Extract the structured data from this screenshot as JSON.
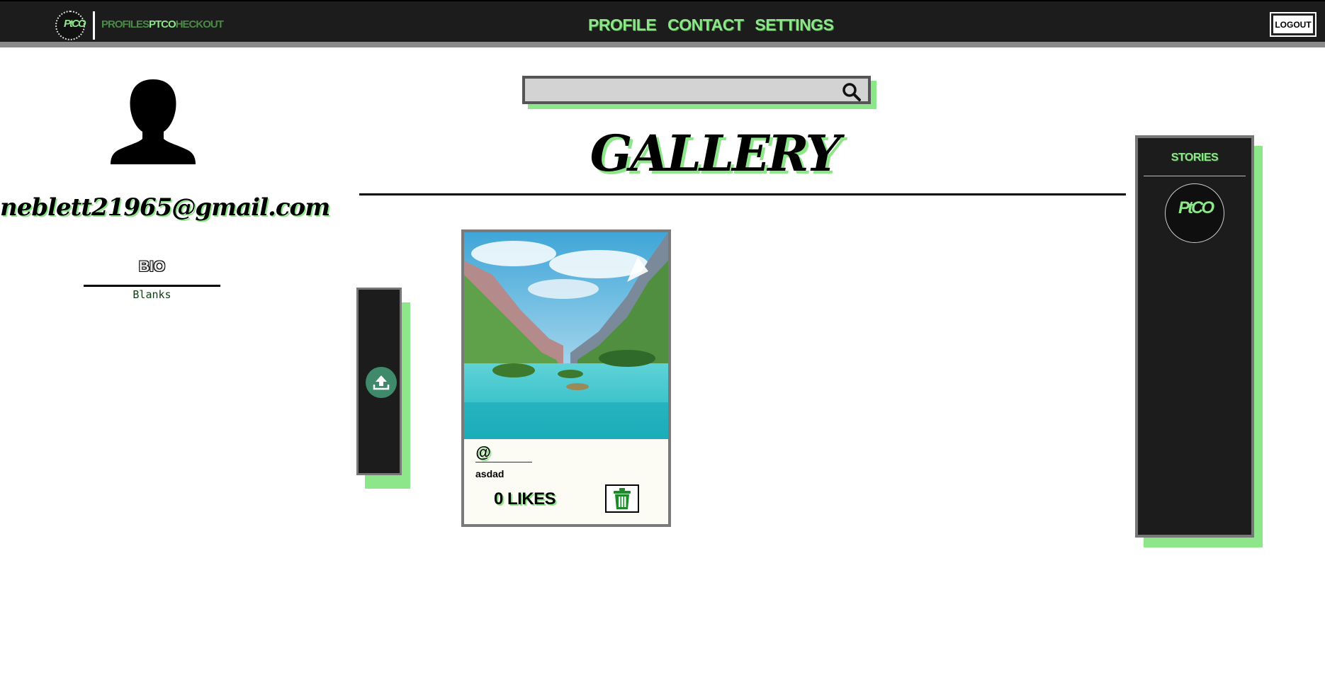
{
  "header": {
    "brand": {
      "part1": "PROFILES",
      "part2": "PTCO",
      "part3": "HECKOUT"
    },
    "logo_text": "PtCO",
    "nav": [
      {
        "label": "PROFILE"
      },
      {
        "label": "CONTACT"
      },
      {
        "label": "SETTINGS"
      }
    ],
    "logout_label": "LOGOUT"
  },
  "profile": {
    "email": "neblett21965@gmail.com",
    "bio_title": "BIO",
    "bio_text": "Blanks"
  },
  "search": {
    "value": "",
    "placeholder": ""
  },
  "gallery": {
    "title": "GALLERY",
    "posts": [
      {
        "handle": "@",
        "caption": "asdad",
        "likes_label": "0 LIKES"
      }
    ]
  },
  "stories": {
    "title": "STORIES",
    "items": [
      {
        "logo_text": "PtCO"
      }
    ]
  },
  "colors": {
    "accent": "#8ee68a",
    "dark": "#1c1c1c",
    "border": "#777777"
  }
}
